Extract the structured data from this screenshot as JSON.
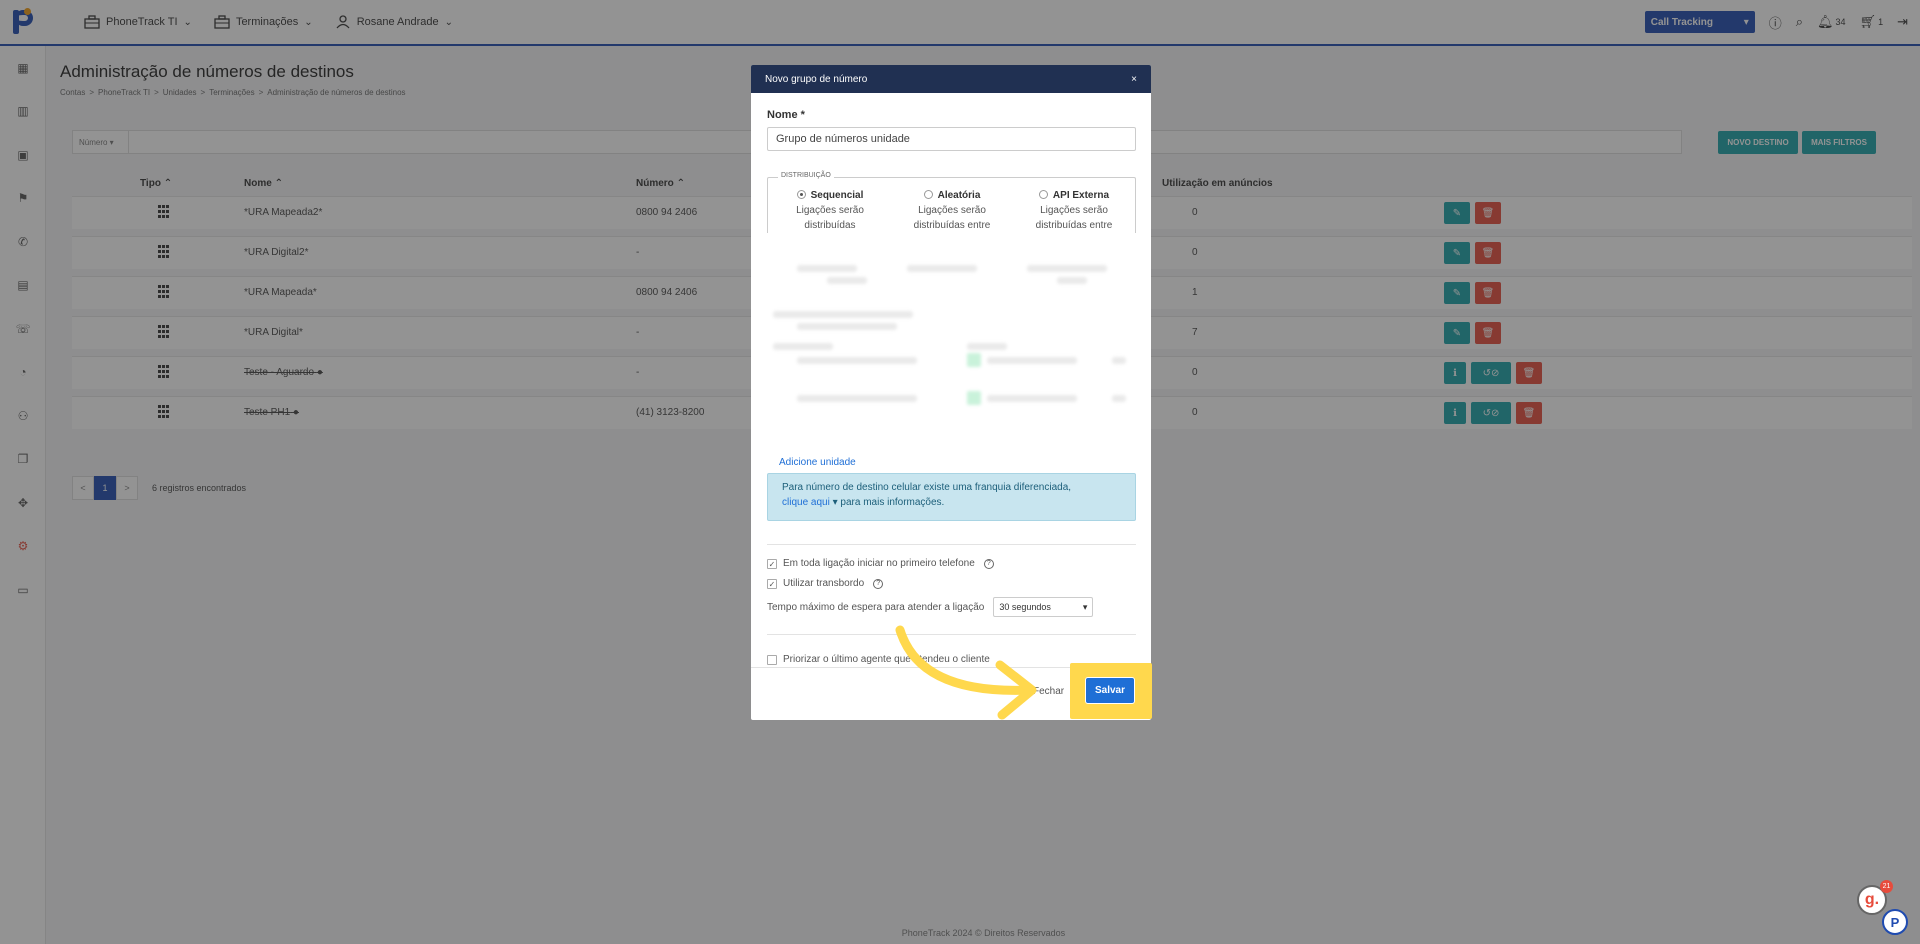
{
  "topbar": {
    "nav": [
      {
        "label": "PhoneTrack TI"
      },
      {
        "label": "Terminações"
      },
      {
        "label": "Rosane Andrade"
      }
    ],
    "select_label": "Call Tracking",
    "notifications_count": "34",
    "cart_count": "1"
  },
  "page": {
    "title": "Administração de números de destinos",
    "breadcrumb": [
      "Contas",
      ">",
      "PhoneTrack TI",
      ">",
      "Unidades",
      ">",
      "Terminações",
      ">",
      "Administração de números de destinos"
    ],
    "filter_select": "Número",
    "btn_new": "NOVO DESTINO",
    "btn_filters": "MAIS FILTROS",
    "columns": [
      "Tipo",
      "Nome",
      "Número",
      "Utilização em anúncios"
    ],
    "rows": [
      {
        "nome": "*URA Mapeada2*",
        "numero": "0800 94 2406",
        "uso": "0"
      },
      {
        "nome": "*URA Digital2*",
        "numero": "-",
        "uso": "0"
      },
      {
        "nome": "*URA Mapeada*",
        "numero": "0800 94 2406",
        "uso": "1"
      },
      {
        "nome": "*URA Digital*",
        "numero": "-",
        "uso": "7"
      },
      {
        "nome": "Teste - Aguardo",
        "numero": "-",
        "uso": "0"
      },
      {
        "nome": "Teste PH1",
        "numero": "(41) 3123-8200",
        "uso": "0"
      }
    ],
    "pager": {
      "prev": "<",
      "current": "1",
      "next": ">",
      "records": "6 registros encontrados"
    },
    "footer": "PhoneTrack 2024 © Direitos Reservados"
  },
  "modal": {
    "title": "Novo grupo de número",
    "close": "×",
    "name_label": "Nome *",
    "name_value": "Grupo de números unidade",
    "distribution_legend": "DISTRIBUIÇÃO",
    "options": [
      {
        "title": "Sequencial",
        "line1": "Ligações serão",
        "line2": "distribuídas"
      },
      {
        "title": "Aleatória",
        "line1": "Ligações serão",
        "line2": "distribuídas entre"
      },
      {
        "title": "API Externa",
        "line1": "Ligações serão",
        "line2": "distribuídas entre"
      }
    ],
    "add_unit": "Adicione unidade",
    "info_text": "Para número de destino celular existe uma franquia diferenciada,",
    "info_link": "clique aqui",
    "info_rest": "para mais informações.",
    "check1": "Em toda ligação iniciar no primeiro telefone",
    "check2": "Utilizar transbordo",
    "wait_label": "Tempo máximo de espera para atender a ligação",
    "wait_value": "30 segundos",
    "check3": "Priorizar o último agente que atendeu o cliente",
    "btn_close": "Fechar",
    "btn_save": "Salvar"
  },
  "widgets": {
    "g_label": "g.",
    "g_badge": "21",
    "p_label": "P"
  },
  "colors": {
    "brand": "#1f4bb0",
    "teal": "#1aa2a8",
    "red": "#e74c3c",
    "highlight": "#ffd84d",
    "save": "#1f6fd6"
  }
}
